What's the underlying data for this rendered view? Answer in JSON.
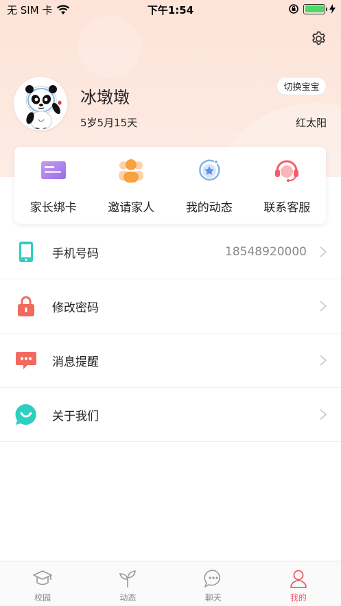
{
  "status_bar": {
    "carrier": "无 SIM 卡",
    "time": "下午1:54"
  },
  "profile": {
    "name": "冰墩墩",
    "age": "5岁5月15天",
    "switch_label": "切换宝宝",
    "class_name": "红太阳"
  },
  "quick_actions": [
    {
      "label": "家长绑卡",
      "icon": "card-icon"
    },
    {
      "label": "邀请家人",
      "icon": "family-icon"
    },
    {
      "label": "我的动态",
      "icon": "moments-icon"
    },
    {
      "label": "联系客服",
      "icon": "customer-service-icon"
    }
  ],
  "settings_list": [
    {
      "label": "手机号码",
      "value": "18548920000",
      "icon": "phone-icon",
      "color": "#2ccfc0"
    },
    {
      "label": "修改密码",
      "value": "",
      "icon": "lock-icon",
      "color": "#f26a5e"
    },
    {
      "label": "消息提醒",
      "value": "",
      "icon": "message-icon",
      "color": "#f26a5e"
    },
    {
      "label": "关于我们",
      "value": "",
      "icon": "smile-icon",
      "color": "#2ccfc0"
    }
  ],
  "tabs": [
    {
      "label": "校园",
      "icon": "campus-icon",
      "active": false
    },
    {
      "label": "动态",
      "icon": "sprout-icon",
      "active": false
    },
    {
      "label": "聊天",
      "icon": "chat-icon",
      "active": false
    },
    {
      "label": "我的",
      "icon": "user-icon",
      "active": true
    }
  ],
  "colors": {
    "accent": "#f05a6a",
    "header_bg": "#fde3d8"
  }
}
